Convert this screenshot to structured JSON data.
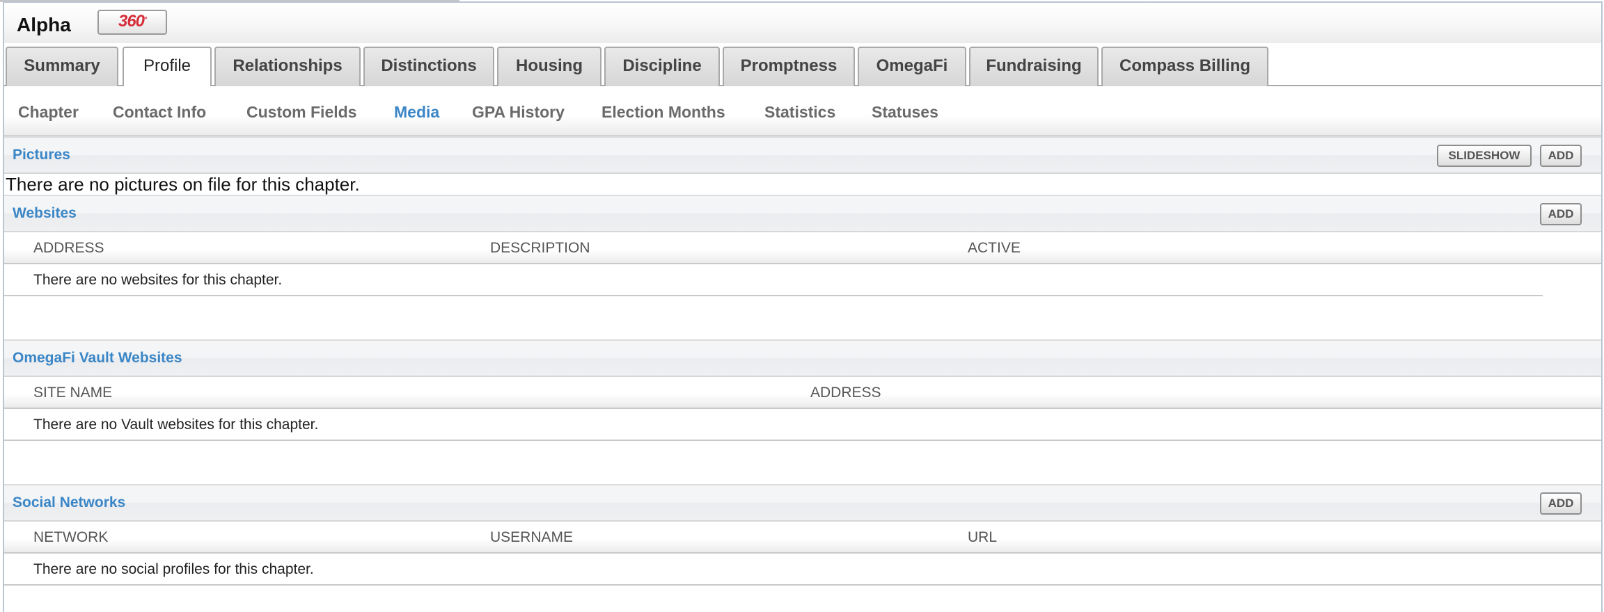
{
  "header": {
    "chapter_name": "Alpha",
    "badge_label": "360",
    "badge_mark": "°"
  },
  "main_tabs": [
    {
      "label": "Summary"
    },
    {
      "label": "Profile",
      "active": true
    },
    {
      "label": "Relationships"
    },
    {
      "label": "Distinctions"
    },
    {
      "label": "Housing"
    },
    {
      "label": "Discipline"
    },
    {
      "label": "Promptness"
    },
    {
      "label": "OmegaFi"
    },
    {
      "label": "Fundraising"
    },
    {
      "label": "Compass Billing"
    }
  ],
  "sub_tabs": [
    {
      "label": "Chapter"
    },
    {
      "label": "Contact Info"
    },
    {
      "label": "Custom Fields"
    },
    {
      "label": "Media",
      "active": true
    },
    {
      "label": "GPA History"
    },
    {
      "label": "Election Months"
    },
    {
      "label": "Statistics"
    },
    {
      "label": "Statuses"
    }
  ],
  "pictures": {
    "title": "Pictures",
    "slideshow_label": "SLIDESHOW",
    "add_label": "ADD",
    "empty_text": "There are no pictures on file for this chapter."
  },
  "websites": {
    "title": "Websites",
    "add_label": "ADD",
    "columns": [
      "ADDRESS",
      "DESCRIPTION",
      "ACTIVE"
    ],
    "empty_text": "There are no websites for this chapter."
  },
  "vault_websites": {
    "title": "OmegaFi Vault Websites",
    "columns": [
      "SITE NAME",
      "ADDRESS"
    ],
    "empty_text": "There are no Vault websites for this chapter."
  },
  "social_networks": {
    "title": "Social Networks",
    "add_label": "ADD",
    "columns": [
      "NETWORK",
      "USERNAME",
      "URL"
    ],
    "empty_text": "There are no social profiles for this chapter."
  },
  "icons": {
    "badge": "360-logo-icon"
  },
  "colors": {
    "link_blue": "#3b86c6",
    "badge_red": "#d42d3a",
    "frame_border": "#b9c5d3"
  }
}
